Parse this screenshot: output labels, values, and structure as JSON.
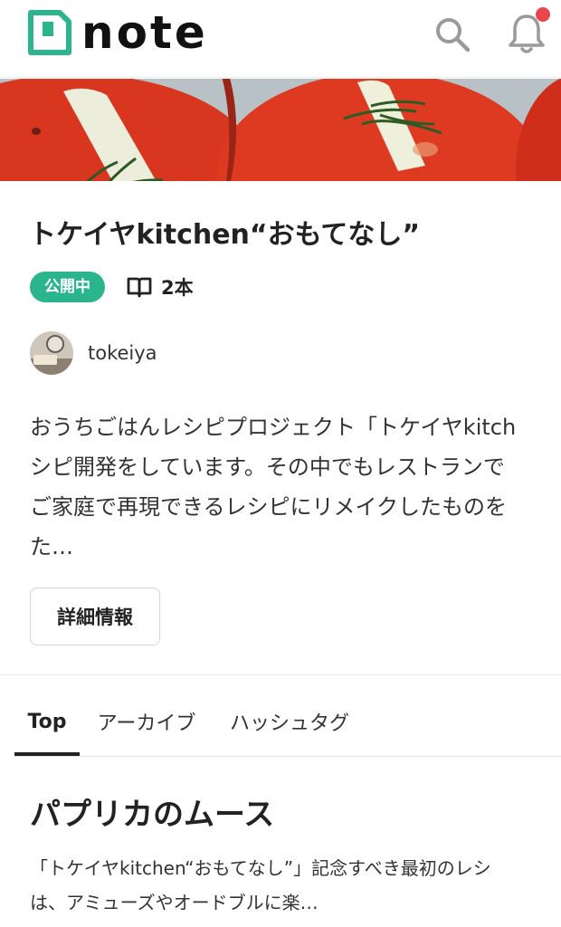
{
  "header": {
    "logo_text": "note",
    "search_icon": "search-icon",
    "bell_icon": "bell-icon",
    "notification_dot_color": "#e9454c"
  },
  "magazine": {
    "title": "トケイヤkitchen“おもてなし”",
    "status_badge": "公開中",
    "status_color": "#2ab58d",
    "count_icon": "book-icon",
    "article_count": "2本",
    "author_name": "tokeiya",
    "description_lines": [
      "おうちごはんレシピプロジェクト「トケイヤkitch",
      "シピ開発をしています。その中でもレストランで",
      "ご家庭で再現できるレシピにリメイクしたものを",
      "た…"
    ],
    "detail_button": "詳細情報"
  },
  "tabs": {
    "items": [
      {
        "label": "Top",
        "active": true
      },
      {
        "label": "アーカイブ",
        "active": false
      },
      {
        "label": "ハッシュタグ",
        "active": false
      }
    ]
  },
  "note_preview": {
    "title": "パプリカのムース",
    "excerpt_lines": [
      "「トケイヤkitchen“おもてなし”」記念すべき最初のレシ",
      "は、アミューズやオードブルに楽…"
    ]
  }
}
